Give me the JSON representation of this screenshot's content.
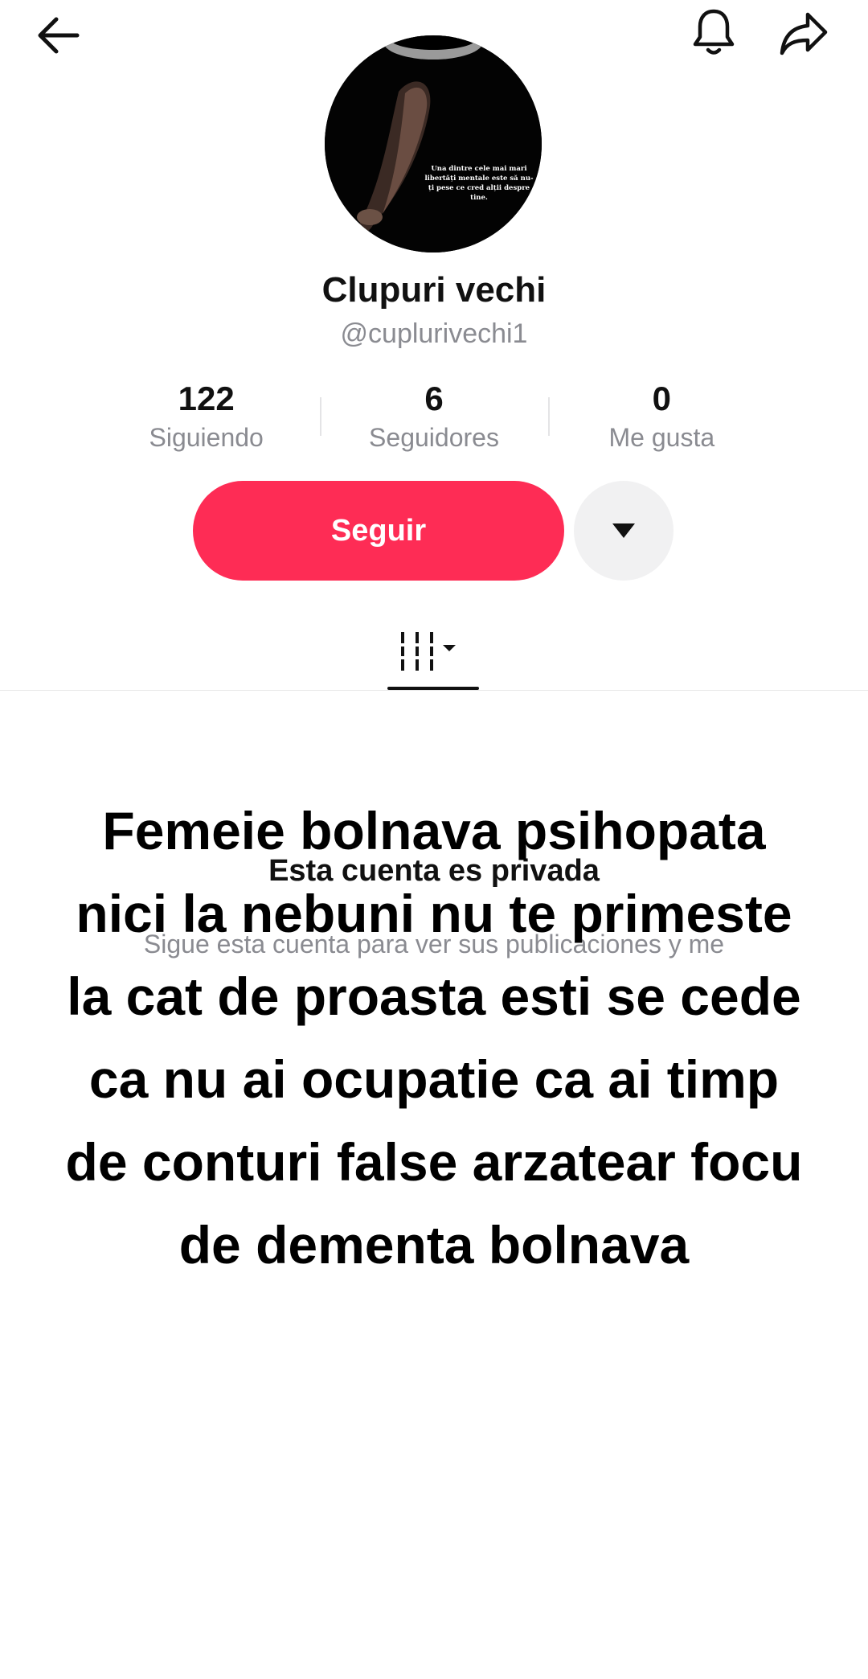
{
  "header": {
    "back_icon": "arrow-left-icon",
    "notification_icon": "bell-icon",
    "share_icon": "share-arrow-icon"
  },
  "profile": {
    "avatar_quote": "Una dintre cele mai mari libertăți mentale este să nu-ți pese ce cred alții despre tine.",
    "display_name": "Clupuri vechi",
    "username": "@cuplurivechi1"
  },
  "stats": [
    {
      "value": "122",
      "label": "Siguiendo"
    },
    {
      "value": "6",
      "label": "Seguidores"
    },
    {
      "value": "0",
      "label": "Me gusta"
    }
  ],
  "actions": {
    "follow_label": "Seguir",
    "more_icon": "caret-down-icon"
  },
  "tabs": {
    "grid_icon": "grid-columns-icon"
  },
  "private": {
    "title": "Esta cuenta es privada",
    "subtitle": "Sigue esta cuenta para ver sus publicaciones y me"
  },
  "overlay": {
    "lines": [
      "Femeie bolnava psihopata",
      "nici la nebuni nu te primeste",
      "la cat de proasta esti se cede",
      "ca nu ai ocupatie ca ai timp",
      "de conturi false arzatear focu",
      "de dementa bolnava"
    ]
  },
  "colors": {
    "accent": "#fe2c55",
    "muted_text": "#8a8b91",
    "button_gray": "#f1f1f2"
  }
}
